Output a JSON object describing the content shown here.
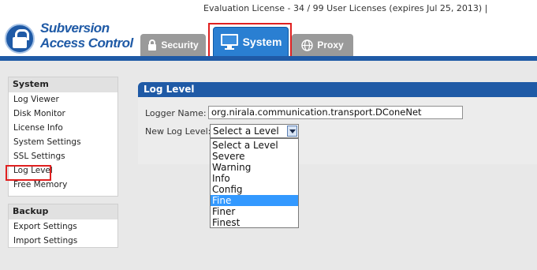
{
  "header": {
    "license_text": "Evaluation License - 34 / 99 User Licenses (expires Jul 25, 2013) |",
    "logo_line1": "Subversion",
    "logo_line2": "Access Control"
  },
  "tabs": [
    {
      "label": "Security",
      "icon": "lock-icon",
      "active": false
    },
    {
      "label": "System",
      "icon": "monitor-icon",
      "active": true
    },
    {
      "label": "Proxy",
      "icon": "globe-icon",
      "active": false
    }
  ],
  "sidebar": {
    "system": {
      "title": "System",
      "items": [
        "Log Viewer",
        "Disk Monitor",
        "License Info",
        "System Settings",
        "SSL Settings",
        "Log Level",
        "Free Memory"
      ]
    },
    "backup": {
      "title": "Backup",
      "items": [
        "Export Settings",
        "Import Settings"
      ]
    }
  },
  "main": {
    "title": "Log Level",
    "logger_label": "Logger Name:",
    "logger_value": "org.nirala.communication.transport.DConeNet",
    "level_label": "New Log Level:",
    "level_selected": "Select a Level",
    "level_options": [
      "Select a Level",
      "Severe",
      "Warning",
      "Info",
      "Config",
      "Fine",
      "Finer",
      "Finest"
    ],
    "highlighted_option": "Fine"
  },
  "colors": {
    "brand_blue": "#1f5aa6",
    "active_tab": "#2a7fd2",
    "inactive_tab": "#9a9a9a",
    "highlight_red": "#e02020",
    "option_highlight": "#3399ff"
  }
}
